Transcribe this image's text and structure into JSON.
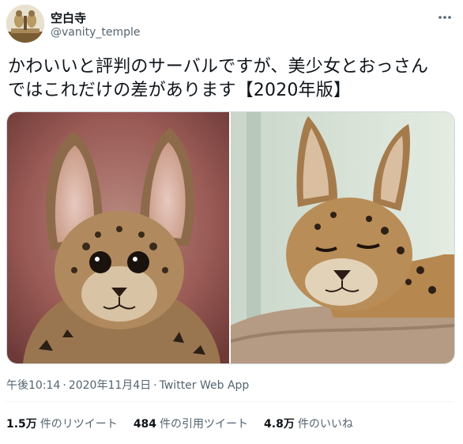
{
  "user": {
    "display_name": "空白寺",
    "handle": "@vanity_temple",
    "avatar_icon": "temple-statue-avatar"
  },
  "tweet": {
    "text": "かわいいと評判のサーバルですが、美少女とおっさん\nではこれだけの差があります【2020年版】",
    "media": [
      {
        "icon": "serval-kitten-photo"
      },
      {
        "icon": "serval-adult-photo"
      }
    ]
  },
  "meta": {
    "time": "午後10:14",
    "separator": "·",
    "date": "2020年11月4日",
    "source": "Twitter Web App"
  },
  "stats": {
    "retweets": {
      "count": "1.5万",
      "label": "件のリツイート"
    },
    "quotes": {
      "count": "484",
      "label": "件の引用ツイート"
    },
    "likes": {
      "count": "4.8万",
      "label": "件のいいね"
    }
  },
  "colors": {
    "text_primary": "#0f1419",
    "text_secondary": "#536471",
    "border": "#cfd9de"
  }
}
